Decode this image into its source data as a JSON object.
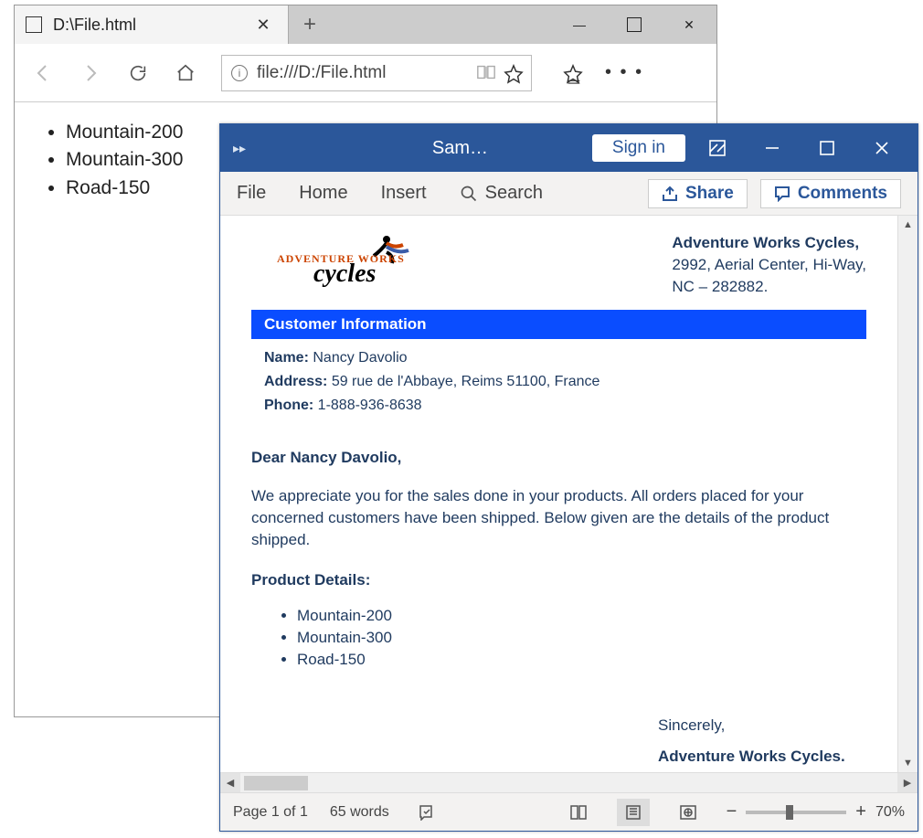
{
  "browser": {
    "tab": {
      "title": "D:\\File.html"
    },
    "address": "file:///D:/File.html",
    "page_items": [
      "Mountain-200",
      "Mountain-300",
      "Road-150"
    ]
  },
  "word": {
    "title": "Sam…",
    "signin": "Sign in",
    "ribbon": {
      "tabs": [
        "File",
        "Home",
        "Insert"
      ],
      "search": "Search",
      "share": "Share",
      "comments": "Comments"
    },
    "doc": {
      "logo_top": "ADVENTURE WORKS",
      "logo_bottom": "cycles",
      "company": {
        "name": "Adventure Works Cycles,",
        "line2": "2992, Aerial Center, Hi-Way,",
        "line3": "NC – 282882."
      },
      "info_heading": "Customer Information",
      "name_label": "Name:",
      "name_value": "Nancy Davolio",
      "address_label": "Address:",
      "address_value": "59 rue de l'Abbaye, Reims 51100, France",
      "phone_label": "Phone:",
      "phone_value": "1-888-936-8638",
      "salutation": "Dear Nancy Davolio,",
      "body": "We appreciate you for the sales done in your products. All orders placed for your concerned customers have been shipped. Below given are the details of the product shipped.",
      "product_title": "Product Details:",
      "products": [
        "Mountain-200",
        "Mountain-300",
        "Road-150"
      ],
      "closing_word": "Sincerely,",
      "signature": "Adventure Works Cycles."
    },
    "status": {
      "page": "Page 1 of 1",
      "words": "65 words",
      "zoom": "70%"
    }
  }
}
